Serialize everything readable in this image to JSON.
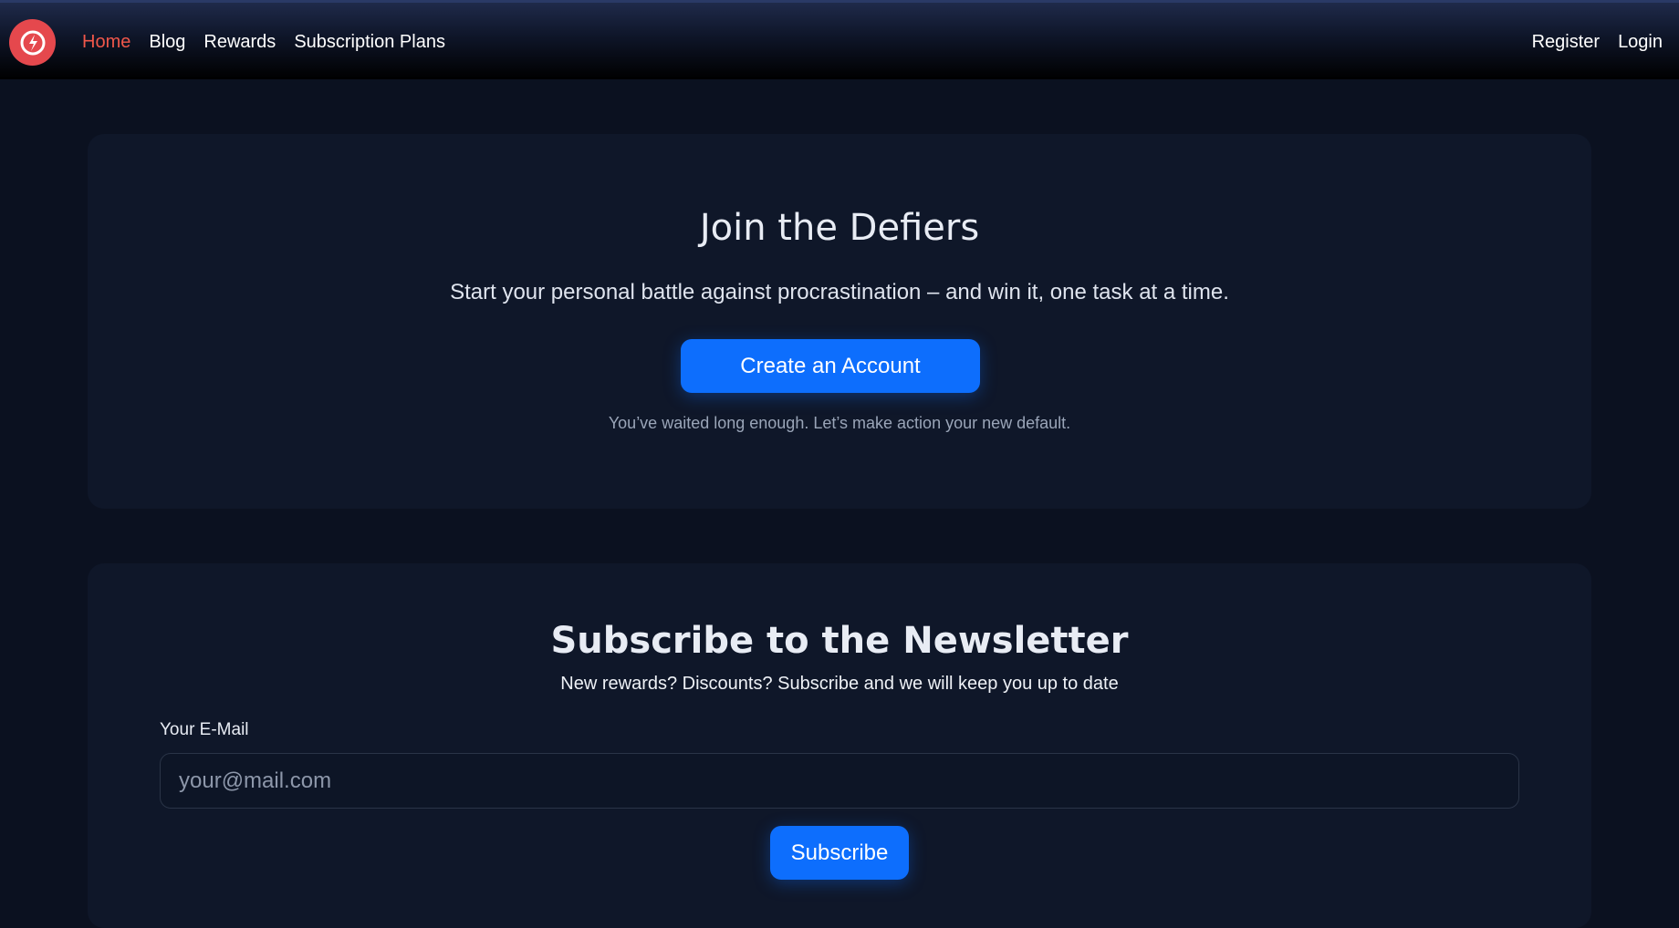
{
  "nav": {
    "logo_icon": "power-swirl-icon",
    "links": [
      "Home",
      "Blog",
      "Rewards",
      "Subscription Plans"
    ],
    "right_links": [
      "Register",
      "Login"
    ],
    "active_color": "#f0574a"
  },
  "join": {
    "title": "Join the Defiers",
    "subtitle": "Start your personal battle against procrastination – and win it, one task at a time.",
    "button": "Create an Account",
    "note": "You’ve waited long enough. Let’s make action your new default."
  },
  "newsletter": {
    "title": "Subscribe to the Newsletter",
    "subtitle": "New rewards? Discounts? Subscribe and we will keep you up to date",
    "email_label": "Your E-Mail",
    "email_placeholder": "your@mail.com",
    "email_value": "",
    "button": "Subscribe"
  },
  "colors": {
    "accent": "#0d6efd",
    "brand": "#e5484d"
  }
}
